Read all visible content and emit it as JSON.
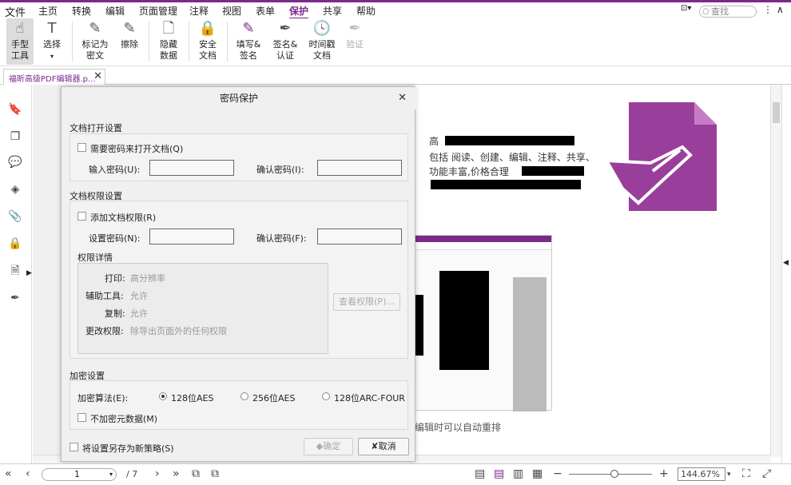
{
  "menubar": {
    "items": [
      "文件",
      "主页",
      "转换",
      "编辑",
      "页面管理",
      "注释",
      "视图",
      "表单",
      "保护",
      "共享",
      "帮助"
    ],
    "active": "保护",
    "search_placeholder": "查找"
  },
  "ribbon": {
    "hand": "手型\n工具",
    "select": "选择",
    "redact": "标记为\n密文",
    "erase": "擦除",
    "hidden_data": "隐藏\n数据",
    "secure_doc": "安全\n文档",
    "fill_sign": "填写&\n签名",
    "sign_cert": "签名&\n认证",
    "timestamp": "时间戳\n文档",
    "verify": "验证"
  },
  "tab": {
    "title": "福昕高级PDF编辑器.p..."
  },
  "document": {
    "line1": "高",
    "line2": "包括 阅读、创建、编辑、注释、共享、",
    "line3": "功能丰富,价格合理",
    "line4": "编辑时可以自动重排",
    "logo_color": "#9a3e9c"
  },
  "dialog": {
    "title": "密码保护",
    "open_section": "文档打开设置",
    "require_open_pw": "需要密码来打开文档(Q)",
    "enter_pw": "输入密码(U):",
    "confirm_pw_1": "确认密码(I):",
    "perm_section": "文档权限设置",
    "add_perm": "添加文档权限(R)",
    "set_pw": "设置密码(N):",
    "confirm_pw_2": "确认密码(F):",
    "perm_details": "权限详情",
    "perms": [
      {
        "label": "打印:",
        "value": "高分辨率"
      },
      {
        "label": "辅助工具:",
        "value": "允许"
      },
      {
        "label": "复制:",
        "value": "允许"
      },
      {
        "label": "更改权限:",
        "value": "除导出页面外的任何权限"
      }
    ],
    "view_perm_btn": "查看权限(P)...",
    "enc_section": "加密设置",
    "enc_algo": "加密算法(E):",
    "algos": [
      "128位AES",
      "256位AES",
      "128位ARC-FOUR"
    ],
    "selected_algo": "128位AES",
    "no_meta": "不加密元数据(M)",
    "save_policy": "将设置另存为新策略(S)",
    "ok": "确定",
    "cancel": "取消"
  },
  "statusbar": {
    "page_current": "1",
    "page_total": "/ 7",
    "zoom": "144.67%"
  },
  "colors": {
    "accent": "#7b2a8c"
  }
}
